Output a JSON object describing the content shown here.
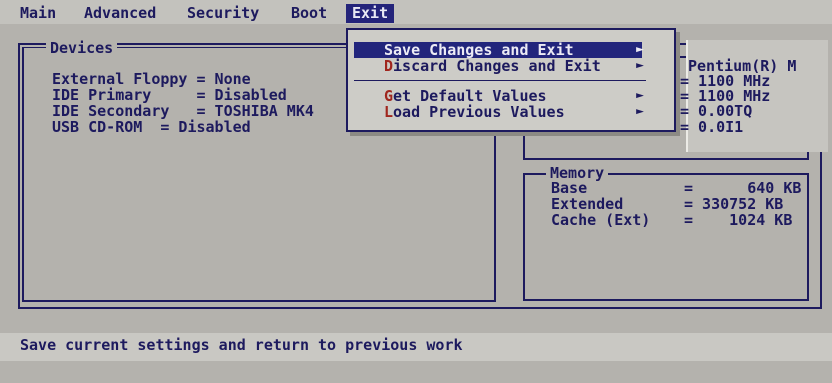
{
  "menubar": {
    "items": [
      "Main",
      "Advanced",
      "Security",
      "Boot",
      "Exit"
    ],
    "active": "Exit"
  },
  "devices": {
    "title": "Devices",
    "lines": [
      "External Floppy = None",
      "IDE Primary     = Disabled",
      "IDE Secondary   = TOSHIBA MK4",
      "USB CD-ROM  = Disabled"
    ]
  },
  "processor": {
    "lines": [
      "Pentium(R) M",
      "= 1100 MHz",
      "= 1100 MHz",
      "= 0.00TQ",
      "= 0.0I1"
    ]
  },
  "memory": {
    "title": "Memory",
    "rows": [
      {
        "label": "Base",
        "value": "=      640 KB"
      },
      {
        "label": "Extended",
        "value": "= 330752 KB"
      },
      {
        "label": "Cache (Ext)",
        "value": "=    1024 KB"
      }
    ]
  },
  "exit_menu": {
    "items": [
      {
        "hot": "",
        "rest": "Save Changes and Exit",
        "arrow": "►",
        "selected": true
      },
      {
        "hot": "D",
        "rest": "iscard Changes and Exit",
        "arrow": "►",
        "selected": false
      },
      {
        "hot": "G",
        "rest": "et Default Values",
        "arrow": "►",
        "selected": false
      },
      {
        "hot": "L",
        "rest": "oad Previous Values",
        "arrow": "►",
        "selected": false
      }
    ]
  },
  "status": {
    "text": "Save current settings and return to previous work"
  },
  "colors": {
    "background": "#b4b2ad",
    "text": "#1d1a5e",
    "highlight": "#22257c",
    "hotkey": "#a0261e"
  }
}
